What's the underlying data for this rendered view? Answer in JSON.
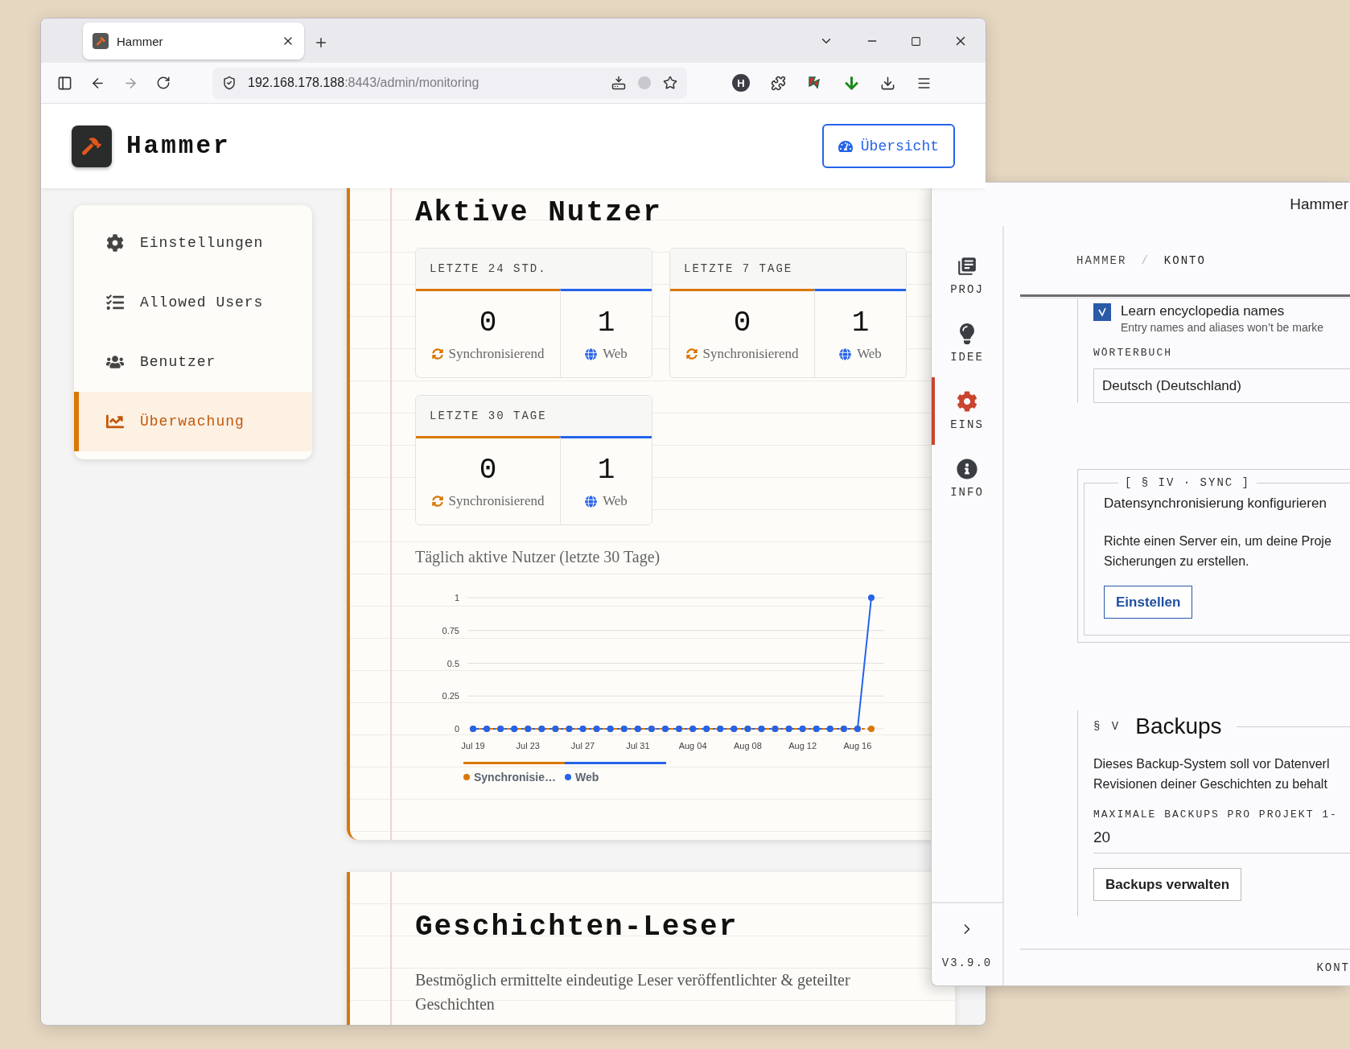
{
  "browser": {
    "tab": {
      "title": "Hammer"
    },
    "address": {
      "host": "192.168.178.188",
      "path": ":8443/admin/monitoring"
    },
    "extension_badge": "H"
  },
  "header": {
    "app_name": "Hammer",
    "overview_button": "Übersicht"
  },
  "sidebar": {
    "items": [
      {
        "label": "Einstellungen",
        "selected": false
      },
      {
        "label": "Allowed Users",
        "selected": false
      },
      {
        "label": "Benutzer",
        "selected": false
      },
      {
        "label": "Überwachung",
        "selected": true
      }
    ]
  },
  "active_users": {
    "title": "Aktive Nutzer",
    "periods": [
      {
        "label": "LETZTE 24 STD.",
        "sync_count": "0",
        "sync_label": "Synchronisierend",
        "web_count": "1",
        "web_label": "Web"
      },
      {
        "label": "LETZTE 7 TAGE",
        "sync_count": "0",
        "sync_label": "Synchronisierend",
        "web_count": "1",
        "web_label": "Web"
      },
      {
        "label": "LETZTE 30 TAGE",
        "sync_count": "0",
        "sync_label": "Synchronisierend",
        "web_count": "1",
        "web_label": "Web"
      }
    ],
    "chart_data": {
      "type": "line",
      "title": "Täglich aktive Nutzer (letzte 30 Tage)",
      "categories": [
        "Jul 19",
        null,
        null,
        null,
        "Jul 23",
        null,
        null,
        null,
        "Jul 27",
        null,
        null,
        null,
        "Jul 31",
        null,
        null,
        null,
        "Aug 04",
        null,
        null,
        null,
        "Aug 08",
        null,
        null,
        null,
        "Aug 12",
        null,
        null,
        null,
        "Aug 16",
        null
      ],
      "grid": true,
      "legend": "bottom",
      "series": [
        {
          "name": "Synchronisie…",
          "color": "#d97706",
          "line_style": "dashed",
          "marker": "circle",
          "values": [
            0,
            0,
            0,
            0,
            0,
            0,
            0,
            0,
            0,
            0,
            0,
            0,
            0,
            0,
            0,
            0,
            0,
            0,
            0,
            0,
            0,
            0,
            0,
            0,
            0,
            0,
            0,
            0,
            0,
            0
          ]
        },
        {
          "name": "Web",
          "color": "#2563eb",
          "line_style": "solid",
          "marker": "circle",
          "values": [
            0,
            0,
            0,
            0,
            0,
            0,
            0,
            0,
            0,
            0,
            0,
            0,
            0,
            0,
            0,
            0,
            0,
            0,
            0,
            0,
            0,
            0,
            0,
            0,
            0,
            0,
            0,
            0,
            0,
            1
          ]
        }
      ],
      "ylim": [
        0,
        1
      ],
      "yticks": [
        0,
        0.25,
        0.5,
        0.75,
        1
      ]
    }
  },
  "readers": {
    "title": "Geschichten-Leser",
    "description": "Bestmöglich ermittelte eindeutige Leser veröffentlichter & geteilter Geschichten"
  },
  "app_window": {
    "title": "Hammer",
    "rail": [
      {
        "label": "PROJ",
        "selected": false
      },
      {
        "label": "IDEE",
        "selected": false
      },
      {
        "label": "EINS",
        "selected": true
      },
      {
        "label": "INFO",
        "selected": false
      }
    ],
    "version": "V3.9.0",
    "breadcrumb": {
      "items": [
        "HAMMER",
        "KONTO"
      ],
      "separator": "/"
    },
    "encyclopedia": {
      "label": "Learn encyclopedia names",
      "checked": true,
      "hint": "Entry names and aliases won’t be marke"
    },
    "dictionary": {
      "label": "WÖRTERBUCH",
      "value": "Deutsch (Deutschland)"
    },
    "sync": {
      "legend": "[ § IV · SYNC ]",
      "heading": "Datensynchronisierung konfigurieren",
      "text_lines": [
        "Richte einen Server ein, um deine Proje",
        "Sicherungen zu erstellen."
      ],
      "button": "Einstellen"
    },
    "backups": {
      "number": "§ V",
      "title": "Backups",
      "text_lines": [
        "Dieses Backup-System soll vor Datenverl",
        "Revisionen deiner Geschichten zu behalt"
      ],
      "max_label": "MAXIMALE BACKUPS PRO PROJEKT 1-",
      "max_value": "20",
      "button": "Backups verwalten"
    },
    "footer": "KONT"
  }
}
